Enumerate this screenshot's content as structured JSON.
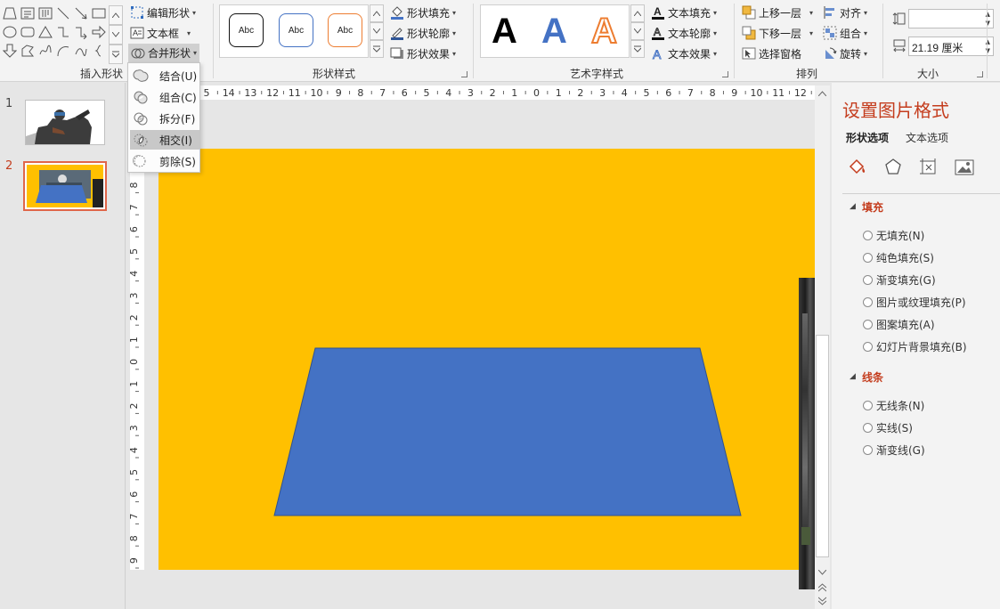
{
  "ribbon": {
    "insert_shapes": {
      "label": "插入形状"
    },
    "edit_shape": "编辑形状",
    "text_box": "文本框",
    "merge_shapes": "合并形状",
    "shape_styles": {
      "label": "形状样式",
      "style_samples": [
        "Abc",
        "Abc",
        "Abc"
      ],
      "fill": "形状填充",
      "outline": "形状轮廓",
      "effects": "形状效果"
    },
    "wordart_styles": {
      "label": "艺术字样式",
      "samples": [
        "A",
        "A",
        "A"
      ],
      "text_fill": "文本填充",
      "text_outline": "文本轮廓",
      "text_effects": "文本效果"
    },
    "arrange": {
      "label": "排列",
      "bring_forward": "上移一层",
      "send_backward": "下移一层",
      "selection_pane": "选择窗格",
      "align": "对齐",
      "group": "组合",
      "rotate": "旋转"
    },
    "size": {
      "label": "大小",
      "height_value": "",
      "width_value": "21.19 厘米"
    }
  },
  "merge_menu": {
    "items": [
      {
        "label": "结合(U)",
        "selected": false
      },
      {
        "label": "组合(C)",
        "selected": false
      },
      {
        "label": "拆分(F)",
        "selected": false
      },
      {
        "label": "相交(I)",
        "selected": true
      },
      {
        "label": "剪除(S)",
        "selected": false
      }
    ]
  },
  "thumbnails": {
    "slides": [
      {
        "number": "1",
        "active": false
      },
      {
        "number": "2",
        "active": true
      }
    ]
  },
  "rulers": {
    "top_labels": [
      "5",
      "14",
      "13",
      "12",
      "11",
      "10",
      "9",
      "8",
      "7",
      "6",
      "5",
      "4",
      "3",
      "2",
      "1",
      "0",
      "1",
      "2",
      "3",
      "4",
      "5",
      "6",
      "7",
      "8",
      "9",
      "10",
      "11",
      "12"
    ],
    "left_labels": [
      "8",
      "7",
      "6",
      "5",
      "4",
      "3",
      "2",
      "1",
      "0",
      "1",
      "2",
      "3",
      "4",
      "5",
      "6",
      "7",
      "8",
      "9"
    ]
  },
  "slide": {
    "background_color": "#ffc000",
    "shape_color": "#4472c4",
    "shape_type": "trapezoid"
  },
  "format_pane": {
    "title": "设置图片格式",
    "tabs": [
      "形状选项",
      "文本选项"
    ],
    "icons": [
      "fill-line-icon",
      "effects-icon",
      "size-properties-icon",
      "picture-icon"
    ],
    "fill_section": {
      "title": "填充",
      "options": [
        "无填充(N)",
        "纯色填充(S)",
        "渐变填充(G)",
        "图片或纹理填充(P)",
        "图案填充(A)",
        "幻灯片背景填充(B)"
      ]
    },
    "line_section": {
      "title": "线条",
      "options": [
        "无线条(N)",
        "实线(S)",
        "渐变线(G)"
      ]
    }
  },
  "colors": {
    "accent_red": "#c43d1e",
    "thumb_border": "#e0664a"
  }
}
